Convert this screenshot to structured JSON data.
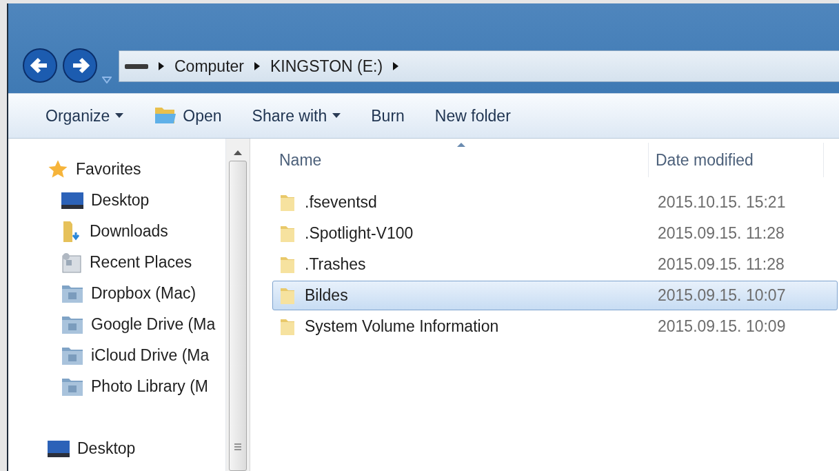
{
  "breadcrumb": [
    "Computer",
    "KINGSTON (E:)"
  ],
  "toolbar": [
    {
      "label": "Organize",
      "kind": "dropdown"
    },
    {
      "label": "Open",
      "kind": "icon"
    },
    {
      "label": "Share with",
      "kind": "dropdown"
    },
    {
      "label": "Burn",
      "kind": "plain"
    },
    {
      "label": "New folder",
      "kind": "plain"
    }
  ],
  "sidebar": {
    "groups": [
      {
        "label": "Favorites",
        "kind": "star",
        "children": [
          {
            "label": "Desktop",
            "kind": "desktop"
          },
          {
            "label": "Downloads",
            "kind": "downloads"
          },
          {
            "label": "Recent Places",
            "kind": "recent"
          },
          {
            "label": "Dropbox (Mac)",
            "kind": "cloud-folder"
          },
          {
            "label": "Google Drive (Ma",
            "kind": "cloud-folder"
          },
          {
            "label": "iCloud Drive (Ma",
            "kind": "cloud-folder"
          },
          {
            "label": "Photo Library (M",
            "kind": "cloud-folder"
          }
        ]
      },
      {
        "label": "Desktop",
        "kind": "desktop"
      }
    ]
  },
  "files": {
    "columns": [
      "Name",
      "Date modified"
    ],
    "rows": [
      {
        "name": ".fseventsd",
        "date": "2015.10.15. 15:21",
        "selected": false
      },
      {
        "name": ".Spotlight-V100",
        "date": "2015.09.15. 11:28",
        "selected": false
      },
      {
        "name": ".Trashes",
        "date": "2015.09.15. 11:28",
        "selected": false
      },
      {
        "name": "Bildes",
        "date": "2015.09.15. 10:07",
        "selected": true
      },
      {
        "name": "System Volume Information",
        "date": "2015.09.15. 10:09",
        "selected": false
      }
    ]
  }
}
